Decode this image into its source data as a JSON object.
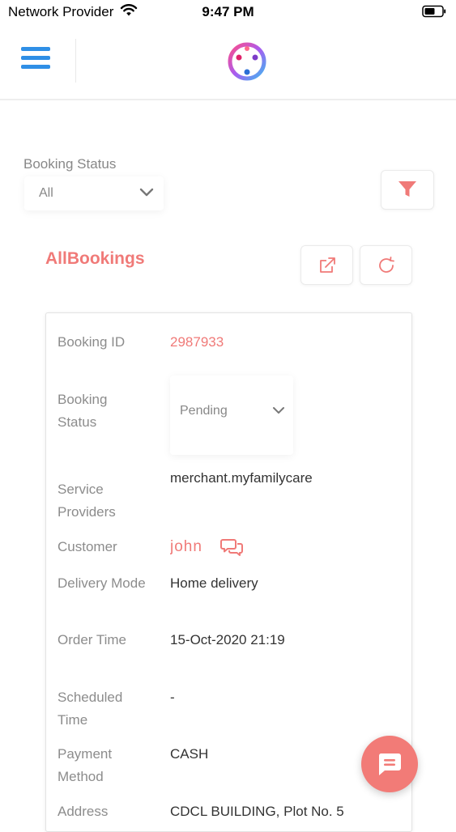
{
  "status_bar": {
    "carrier": "Network Provider",
    "time": "9:47 PM"
  },
  "header": {
    "menu_icon": "hamburger-menu-icon",
    "logo_icon": "app-logo-icon"
  },
  "filter": {
    "label": "Booking Status",
    "selected": "All",
    "filter_icon": "funnel-icon"
  },
  "bookings": {
    "title": "AllBookings",
    "export_icon": "external-link-icon",
    "refresh_icon": "refresh-icon"
  },
  "card": {
    "booking_id": {
      "label": "Booking ID",
      "value": "2987933"
    },
    "booking_status": {
      "label": "Booking Status",
      "value": "Pending"
    },
    "service_providers": {
      "label": "Service Providers",
      "value": "merchant.myfamilycare"
    },
    "customer": {
      "label": "Customer",
      "value": "john"
    },
    "delivery_mode": {
      "label": "Delivery Mode",
      "value": "Home delivery"
    },
    "order_time": {
      "label": "Order Time",
      "value": "15-Oct-2020 21:19"
    },
    "scheduled_time": {
      "label": "Scheduled Time",
      "value": "-"
    },
    "payment_method": {
      "label": "Payment Method",
      "value": "CASH"
    },
    "address": {
      "label": "Address",
      "value": "CDCL BUILDING, Plot No. 5"
    }
  },
  "fab": {
    "icon": "chat-bubble-icon"
  },
  "colors": {
    "accent": "#f07a78",
    "menu_blue": "#2f8fe6",
    "label_gray": "#8c8c8c"
  }
}
